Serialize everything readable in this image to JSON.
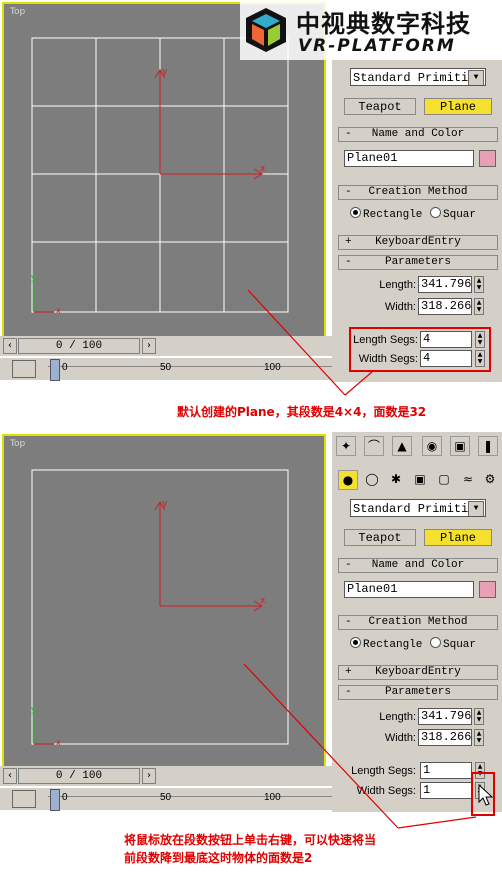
{
  "logo": {
    "cn": "中视典数字科技",
    "en": "VR-PLATFORM"
  },
  "panels": [
    {
      "viewport_label": "Top",
      "time_field": "0 / 100",
      "track_ticks": [
        "0",
        "50",
        "100"
      ],
      "dropdown": "Standard Primitiv",
      "buttons": {
        "teapot": "Teapot",
        "plane": "Plane"
      },
      "rollouts": {
        "name_color": "Name and Color",
        "creation": "Creation Method",
        "keyboard": "KeyboardEntry",
        "params": "Parameters"
      },
      "name_value": "Plane01",
      "radio_rect": "Rectangle",
      "radio_square": "Squar",
      "length_label": "Length:",
      "length_value": "341.796",
      "width_label": "Width:",
      "width_value": "318.266",
      "lsegs_label": "Length Segs:",
      "lsegs_value": "4",
      "wsegs_label": "Width Segs:",
      "wsegs_value": "4",
      "caption": "默认创建的Plane，其段数是4×4，面数是32"
    },
    {
      "viewport_label": "Top",
      "time_field": "0 / 100",
      "track_ticks": [
        "0",
        "50",
        "100"
      ],
      "dropdown": "Standard Primitiv",
      "buttons": {
        "teapot": "Teapot",
        "plane": "Plane"
      },
      "rollouts": {
        "name_color": "Name and Color",
        "creation": "Creation Method",
        "keyboard": "KeyboardEntry",
        "params": "Parameters"
      },
      "name_value": "Plane01",
      "radio_rect": "Rectangle",
      "radio_square": "Squar",
      "length_label": "Length:",
      "length_value": "341.796",
      "width_label": "Width:",
      "width_value": "318.266",
      "lsegs_label": "Length Segs:",
      "lsegs_value": "1",
      "wsegs_label": "Width Segs:",
      "wsegs_value": "1",
      "caption_line1": "将鼠标放在段数按钮上单击右键，可以快速将当",
      "caption_line2": "前段数降到最底这时物体的面数是2"
    }
  ],
  "axis": {
    "x": "x",
    "y": "y"
  },
  "colors": {
    "viewport_border": "#e0e000",
    "highlight": "#e00000",
    "active_button": "#f5e030",
    "swatch": "#e8a0b4"
  }
}
